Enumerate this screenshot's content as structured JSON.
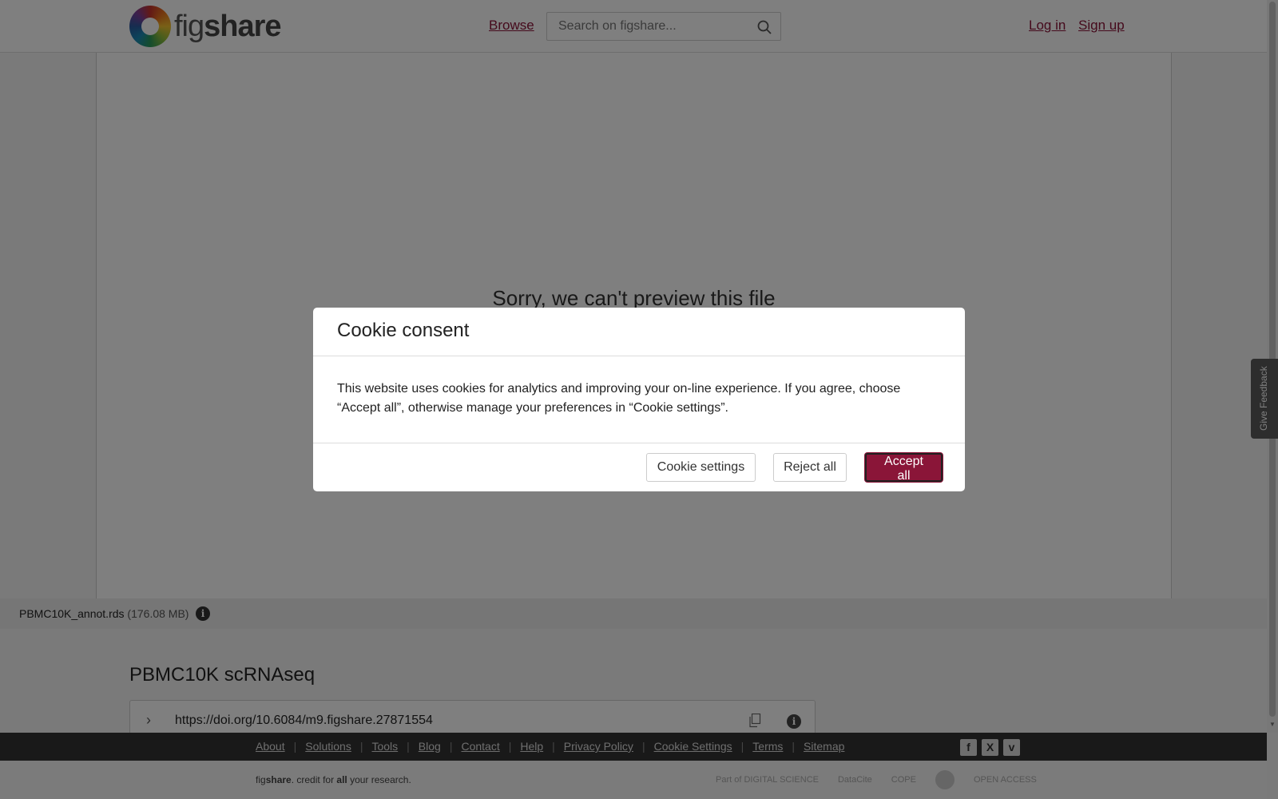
{
  "header": {
    "logo_fig": "fig",
    "logo_share": "share",
    "browse": "Browse",
    "search_placeholder": "Search on figshare...",
    "login": "Log in",
    "signup": "Sign up"
  },
  "preview": {
    "message": "Sorry, we can't preview this file"
  },
  "file": {
    "name": "PBMC10K_annot.rds",
    "size": "(176.08 MB)",
    "info_icon": "i"
  },
  "item": {
    "title": "PBMC10K scRNAseq",
    "doi": "https://doi.org/10.6084/m9.figshare.27871554",
    "chevron": "›",
    "info_icon": "i"
  },
  "footer": {
    "links": [
      "About",
      "Solutions",
      "Tools",
      "Blog",
      "Contact",
      "Help",
      "Privacy Policy",
      "Cookie Settings",
      "Terms",
      "Sitemap"
    ],
    "separator": "|",
    "social": [
      "f",
      "X",
      "v"
    ],
    "tagline_pre": "fig",
    "tagline_bold": "share",
    "tagline_mid": ". credit for ",
    "tagline_all": "all",
    "tagline_post": " your research.",
    "partners": [
      "Part of DIGITAL SCIENCE",
      "DataCite",
      "COPE",
      "OPEN ACCESS"
    ]
  },
  "feedback": {
    "label": "Give Feedback"
  },
  "modal": {
    "title": "Cookie consent",
    "body": "This website uses cookies for analytics and improving your on-line experience. If you agree, choose “Accept all”, otherwise manage your preferences in “Cookie settings”.",
    "settings_label": "Cookie settings",
    "reject_label": "Reject all",
    "accept_label": "Accept all"
  },
  "colors": {
    "brand": "#8a1538",
    "footer_bg": "#333333"
  }
}
